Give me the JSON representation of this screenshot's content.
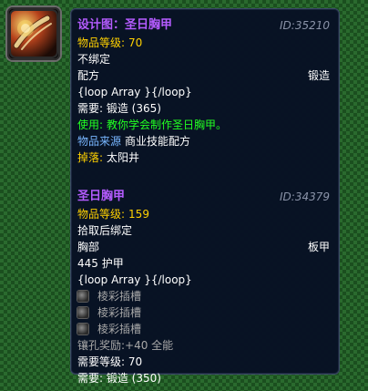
{
  "item_icon": "armor-pattern-icon",
  "colors": {
    "epic_title": "#b55cff",
    "label_yellow": "#ffd100",
    "use_green": "#22ff22",
    "source_blue": "#78b6ff",
    "muted_gray": "#a8a8a8",
    "id_gray": "#8a93a8",
    "tooltip_bg": "#071024",
    "page_green": "#1b4f1f"
  },
  "pattern": {
    "title": "设计图：圣日胸甲",
    "id": "ID:35210",
    "item_level_label": "物品等级:",
    "item_level_value": "70",
    "bind": "不绑定",
    "type_left": "配方",
    "type_right": "锻造",
    "loop": "{loop Array }{/loop}",
    "requires": "需要: 锻造 (365)",
    "use_label": "使用:",
    "use_text": "教你学会制作圣日胸甲。",
    "source_label": "物品来源",
    "source_text": "商业技能配方",
    "drop_label": "掉落:",
    "drop_text": "太阳井"
  },
  "result": {
    "title": "圣日胸甲",
    "id": "ID:34379",
    "item_level_label": "物品等级:",
    "item_level_value": "159",
    "bind": "拾取后绑定",
    "slot_left": "胸部",
    "slot_right": "板甲",
    "armor": "445 护甲",
    "loop": "{loop Array }{/loop}",
    "sockets": [
      {
        "icon": "prismatic-socket-icon",
        "label": "棱彩插槽"
      },
      {
        "icon": "prismatic-socket-icon",
        "label": "棱彩插槽"
      },
      {
        "icon": "prismatic-socket-icon",
        "label": "棱彩插槽"
      }
    ],
    "socket_bonus": "镶孔奖励:+40 全能",
    "req_level": "需要等级: 70",
    "req_skill": "需要: 锻造 (350)"
  }
}
